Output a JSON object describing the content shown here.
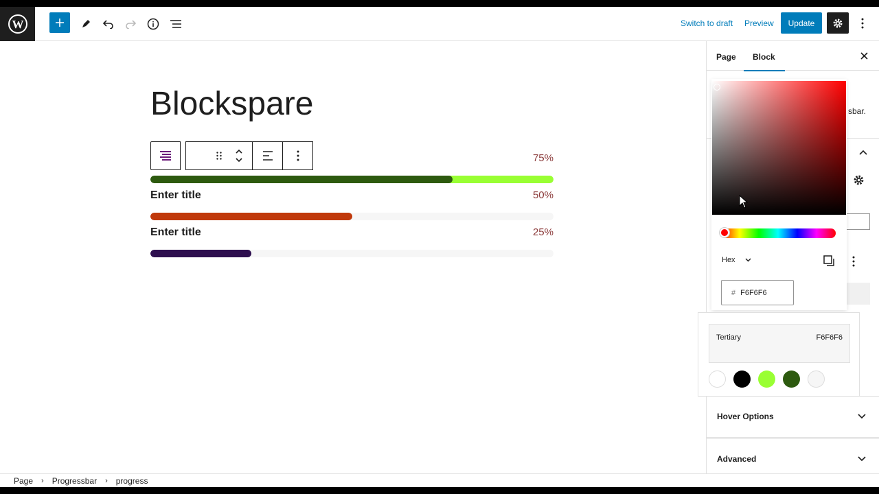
{
  "toolbar": {
    "switch_draft": "Switch to draft",
    "preview": "Preview",
    "update": "Update",
    "icons": [
      "wordpress-logo",
      "plus-icon",
      "pencil-icon",
      "undo-icon",
      "redo-icon",
      "info-icon",
      "list-view-icon",
      "gear-icon",
      "more-vertical-icon"
    ]
  },
  "editor": {
    "title": "Blockspare",
    "progress_bars": [
      {
        "title": "",
        "percent_label": "75%",
        "percent": 75,
        "fill_color": "#2d5a0f",
        "rest_color": "#99ff33",
        "pct_color": "#8b3a3a"
      },
      {
        "title": "Enter title",
        "percent_label": "50%",
        "percent": 50,
        "fill_color": "#c0390b",
        "rest_color": "#f6f6f6",
        "pct_color": "#8b3a3a"
      },
      {
        "title": "Enter title",
        "percent_label": "25%",
        "percent": 25,
        "fill_color": "#2e0f4f",
        "rest_color": "#f6f6f6",
        "pct_color": "#8b3a3a"
      }
    ]
  },
  "breadcrumb": {
    "items": [
      "Page",
      "Progressbar",
      "progress"
    ]
  },
  "sidebar": {
    "tabs": [
      "Page",
      "Block"
    ],
    "active_tab": "Block",
    "partial_text": "sbar.",
    "panels": [
      "Hover Options",
      "Advanced"
    ]
  },
  "color_picker": {
    "mode": "Hex",
    "hex_prefix": "#",
    "hex_value": "F6F6F6",
    "current_name": "Tertiary",
    "current_hex": "F6F6F6",
    "swatches": [
      "#ffffff",
      "#000000",
      "#99ff33",
      "#2d5a0f",
      "#f6f6f6"
    ]
  }
}
